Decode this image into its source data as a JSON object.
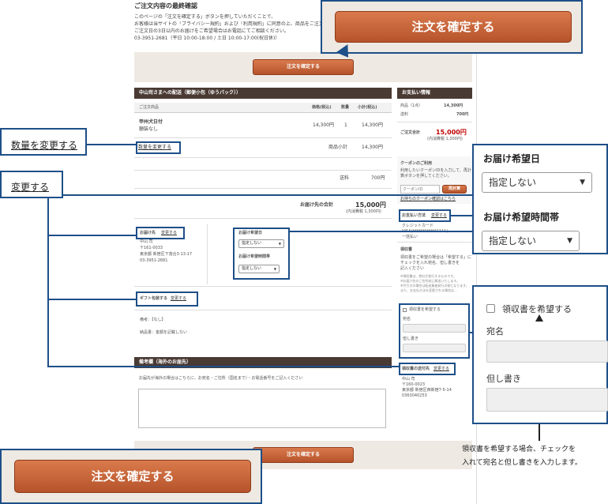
{
  "page": {
    "title": "ご注文内容の最終確認",
    "intro_1": "このページの「注文を確定する」ボタンを押していただくことで、",
    "intro_2": "お客様は当サイトの「プライバシー規約」および「利用規約」に同意の上、商品をご注文されたことになります。",
    "intro_3": "ご注文日の3日以内のお届けをご希望場合はお電話にてご相談ください。",
    "intro_4": "03-3951-2681（平日 10:00-18:00 / 土日 10:00-17:00(祝日休)）",
    "confirm_label": "注文を確定する"
  },
  "delivery": {
    "header": "中山司さまへの配送（郵便小包（ゆうパック））",
    "col_item": "ご注文商品",
    "col_price": "価格(税込)",
    "col_qty": "数量",
    "col_subtotal": "小計(税込)",
    "item_name": "甲州犬日付",
    "item_option": "額装なし",
    "item_price": "14,300円",
    "item_qty": "1",
    "item_subtotal": "14,300円",
    "change_qty": "数量を変更する",
    "goods_subtotal_label": "商品小計",
    "goods_subtotal": "14,300円",
    "shipping_label": "送料",
    "shipping": "700円",
    "total_label": "お届け先の合計",
    "total": "15,000円",
    "total_tax": "(内消費税 1,300円)",
    "address_label": "お届け先",
    "change": "変更する",
    "addr_name": "中山 司",
    "addr_zip": "〒161-0033",
    "addr_street": "東京都 新宿区下落合3-13-17",
    "addr_tel": "03-3951-2681",
    "date_label": "お届け希望日",
    "time_label": "お届け希望時間帯",
    "not_specified": "指定しない",
    "gift_label": "ギフト包装する",
    "memo": "備考：【なし】",
    "invoice_note": "納品書：金額を記載しない"
  },
  "remarks": {
    "header": "備考欄（海外のお届先）",
    "text": "お届先が海外の場合はこちらに、お宛名・ご住所（国名まで）・お電話番号をご記入ください"
  },
  "payment": {
    "header": "お支払い情報",
    "goods_label": "商品（1点）",
    "goods": "14,300円",
    "shipping_label": "送料",
    "shipping": "700円",
    "total_label": "ご注文合計",
    "total": "15,000円",
    "total_tax": "(内消費税 1,300円)",
    "coupon_title": "クーポンのご利用",
    "coupon_desc_1": "利用したいクーポンIDを入力して、再計",
    "coupon_desc_2": "算ボタンを押してください。",
    "coupon_placeholder": "クーポンID",
    "recalc": "再計算",
    "coupon_link": "お持ちのクーポン確認はこちら",
    "method_label": "お支払い方法",
    "method_change": "変更する",
    "card_1": "クレジットカード",
    "card_2": "VISA(************1111)",
    "card_3": "一括払い",
    "receipt_title": "領収書",
    "receipt_d1": "領収書をご希望の場合は「希望する」に",
    "receipt_d2": "チェックを入れ宛名、但し書きを",
    "receipt_d3": "記入ください",
    "receipt_small_1": "※領収書は、弊社が発行するものです。",
    "receipt_small_2": "※お届け先のご住所宛に郵送いたします。",
    "receipt_small_3": "※代引きの場合は配送業者発行の物となります。",
    "receipt_small_4": "また、お支払方法を変更される場合は...",
    "receipt_want": "領収書を希望する",
    "atena": "宛名",
    "tadashi": "但し書き",
    "receipt_dest_label": "領収書の送付先",
    "receipt_dest_change": "変更する",
    "dest_name": "中山 司",
    "dest_zip": "〒160-0023",
    "dest_street": "東京都 新宿区西新宿7-5-14",
    "dest_tel": "0363040253"
  },
  "callouts": {
    "qty": "数量を変更する",
    "change": "変更する",
    "date_label": "お届け希望日",
    "time_label": "お届け希望時間帯",
    "not_specified": "指定しない",
    "receipt_want": "領収書を希望する",
    "atena": "宛名",
    "tadashi": "但し書き",
    "note_1": "領収書を希望する場合、チェックを",
    "note_2": "入れて宛名と但し書きを入力します。"
  },
  "colors": {
    "accent": "#c0603a",
    "callout": "#1d4f88",
    "header_bar": "#4a3a34",
    "total_red": "#c00000"
  }
}
